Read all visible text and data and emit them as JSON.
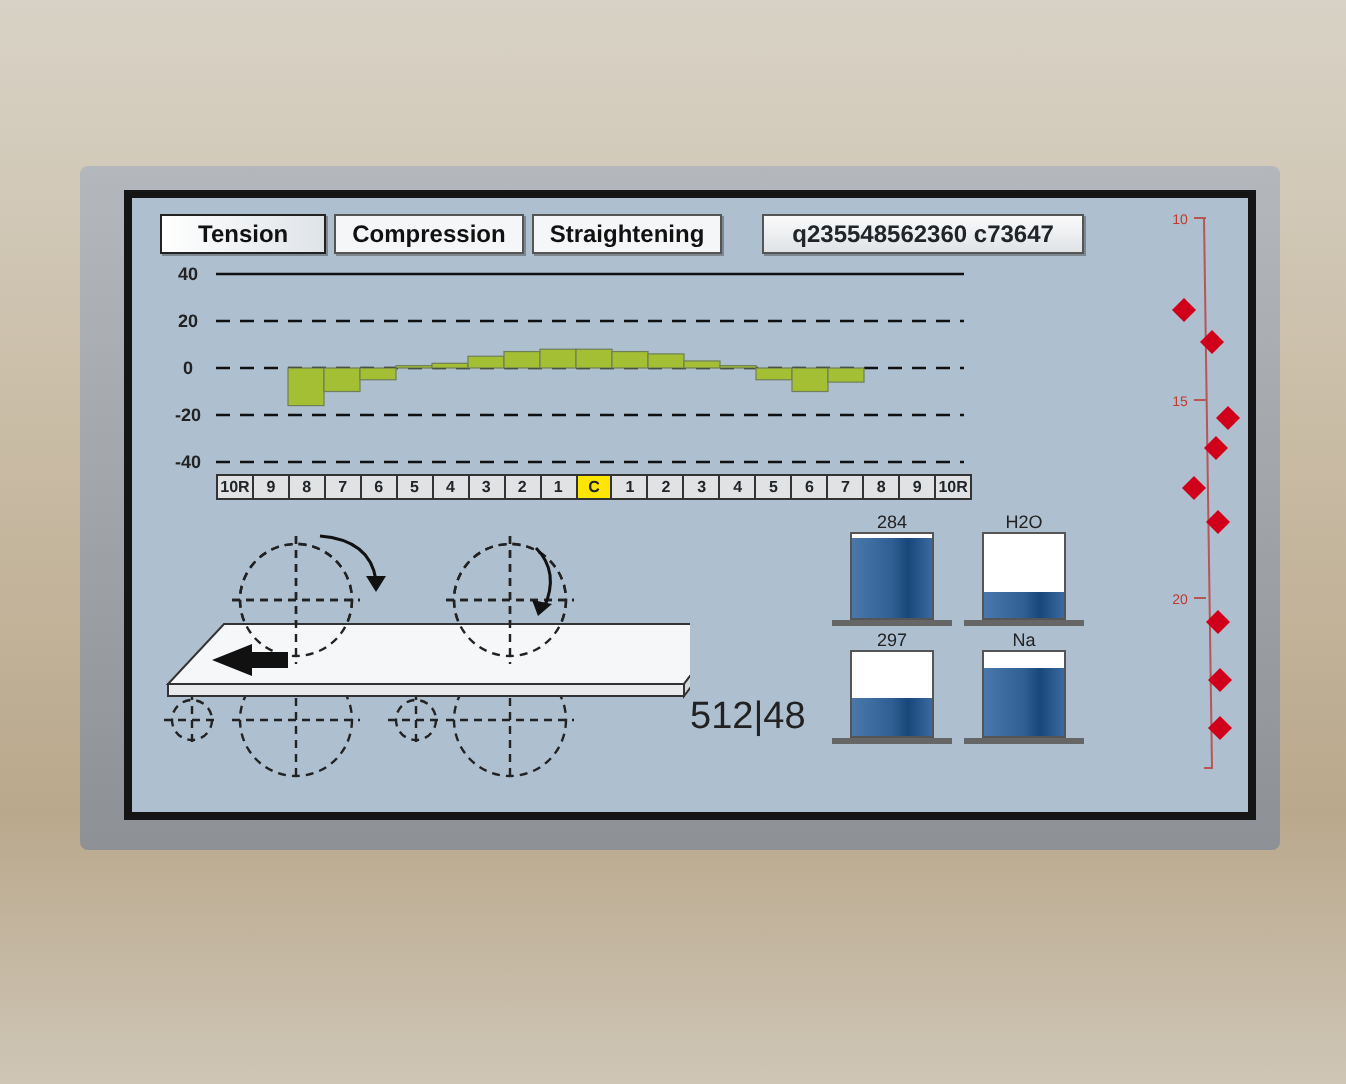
{
  "tabs": [
    {
      "label": "Tension",
      "selected": true
    },
    {
      "label": "Compression",
      "selected": false
    },
    {
      "label": "Straightening",
      "selected": false
    }
  ],
  "status_code": "q235548562360 c73647",
  "profile_chart": {
    "chart_data": {
      "type": "bar",
      "categories": [
        "10R",
        "9",
        "8",
        "7",
        "6",
        "5",
        "4",
        "3",
        "2",
        "1",
        "C",
        "1",
        "2",
        "3",
        "4",
        "5",
        "6",
        "7",
        "8",
        "9",
        "10R"
      ],
      "series": [
        {
          "color": "#a4bf33",
          "values": [
            null,
            null,
            -16,
            -10,
            -5,
            1,
            2,
            5,
            7,
            8,
            8,
            7,
            6,
            3,
            1,
            -5,
            -10,
            -6,
            null,
            null,
            null
          ]
        }
      ],
      "ylim": [
        -40,
        40
      ],
      "grid": true,
      "yticks": [
        -40,
        -20,
        0,
        20,
        40
      ]
    },
    "category_states": [
      {
        "selected": false
      },
      {
        "selected": false
      },
      {
        "selected": false
      },
      {
        "selected": false
      },
      {
        "selected": false
      },
      {
        "selected": false
      },
      {
        "selected": false
      },
      {
        "selected": false
      },
      {
        "selected": false
      },
      {
        "selected": false
      },
      {
        "selected": true
      },
      {
        "selected": false
      },
      {
        "selected": false
      },
      {
        "selected": false
      },
      {
        "selected": false
      },
      {
        "selected": false
      },
      {
        "selected": false
      },
      {
        "selected": false
      },
      {
        "selected": false
      },
      {
        "selected": false
      },
      {
        "selected": false
      }
    ]
  },
  "roll_reading": "512|48",
  "tanks": [
    {
      "label": "284",
      "level": 0.95
    },
    {
      "label": "H2O",
      "level": 0.3
    },
    {
      "label": "297",
      "level": 0.45
    },
    {
      "label": "Na",
      "level": 0.8
    }
  ],
  "depth_scale": {
    "labels": [
      "10",
      "15",
      "20"
    ]
  }
}
